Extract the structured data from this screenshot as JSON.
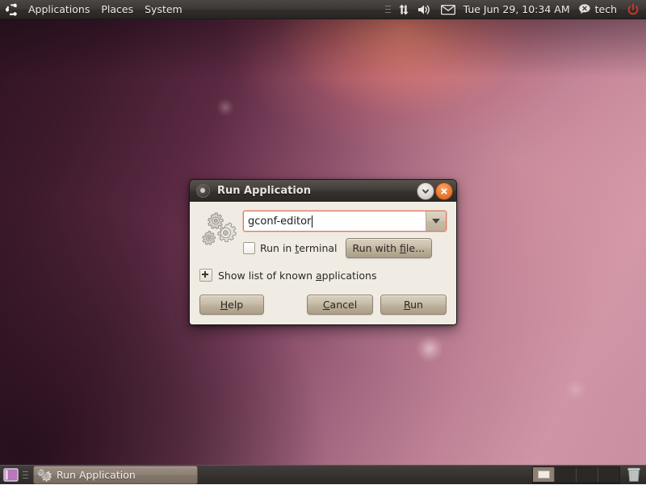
{
  "top_panel": {
    "logo_icon": "ubuntu-logo-icon",
    "menus": [
      {
        "label": "Applications",
        "name": "menu-applications"
      },
      {
        "label": "Places",
        "name": "menu-places"
      },
      {
        "label": "System",
        "name": "menu-system"
      }
    ],
    "tray": {
      "grip": "panel-grip-handle",
      "network_icon": "network-transfer-icon",
      "volume_icon": "volume-speaker-icon",
      "mail_icon": "mail-envelope-icon"
    },
    "clock": "Tue Jun 29, 10:34 AM",
    "user": {
      "name": "tech",
      "status_icon": "chat-status-offline-icon"
    },
    "power_icon": "power-button-icon"
  },
  "dialog": {
    "title": "Run Application",
    "window_icon": "window-menu-icon",
    "minimize_icon": "minimize-chevron-icon",
    "close_icon": "close-x-icon",
    "app_icon": "gears-run-icon",
    "command_value": "gconf-editor",
    "command_placeholder": "",
    "dropdown_icon": "chevron-down-icon",
    "run_in_terminal": {
      "label_before": "Run in ",
      "label_mnemonic": "t",
      "label_after": "erminal",
      "checked": false
    },
    "run_with_file": {
      "label_before": "Run with ",
      "label_mnemonic": "f",
      "label_after": "ile..."
    },
    "expander": {
      "icon": "expander-plus-icon",
      "label_before": "Show list of known ",
      "label_mnemonic": "a",
      "label_after": "pplications",
      "expanded": false
    },
    "buttons": {
      "help": {
        "before": "",
        "mnemonic": "H",
        "after": "elp"
      },
      "cancel": {
        "before": "",
        "mnemonic": "C",
        "after": "ancel"
      },
      "run": {
        "before": "",
        "mnemonic": "R",
        "after": "un"
      }
    }
  },
  "bottom_panel": {
    "show_desktop_icon": "show-desktop-icon",
    "grip": "taskbar-grip-handle",
    "task": {
      "label": "Run Application",
      "icon": "gears-run-icon"
    },
    "workspaces": [
      {
        "name": "workspace-1",
        "active": true
      },
      {
        "name": "workspace-2",
        "active": false
      },
      {
        "name": "workspace-3",
        "active": false
      },
      {
        "name": "workspace-4",
        "active": false
      }
    ],
    "trash_icon": "trash-can-icon"
  },
  "colors": {
    "panel_dark": "#373330",
    "dialog_bg": "#f0ece4",
    "focus_ring": "#e0775e",
    "close_orange": "#ea7b36",
    "power_red": "#d2352b",
    "wallpaper_purple": "#5b2942",
    "wallpaper_glow": "#ff8c6e"
  }
}
